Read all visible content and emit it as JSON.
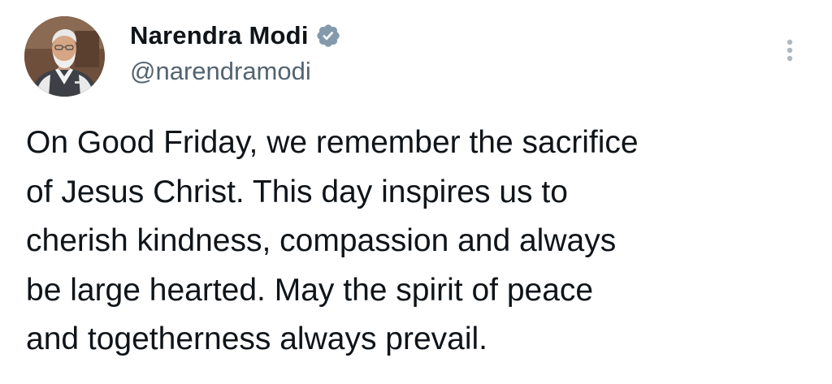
{
  "author": {
    "display_name": "Narendra Modi",
    "handle": "@narendramodi",
    "verified_icon": "verified-badge-icon",
    "avatar_icon": "profile-avatar"
  },
  "menu": {
    "icon": "more-vertical-icon"
  },
  "tweet": {
    "lines": [
      "On Good Friday, we remember the sacrifice",
      "of Jesus Christ. This day inspires us to",
      "cherish kindness, compassion and always",
      "be large hearted. May the spirit of peace",
      "and togetherness always prevail."
    ]
  },
  "colors": {
    "text": "#0f1419",
    "secondary_text": "#536471",
    "verified_badge": "#829aab",
    "background": "#ffffff"
  }
}
